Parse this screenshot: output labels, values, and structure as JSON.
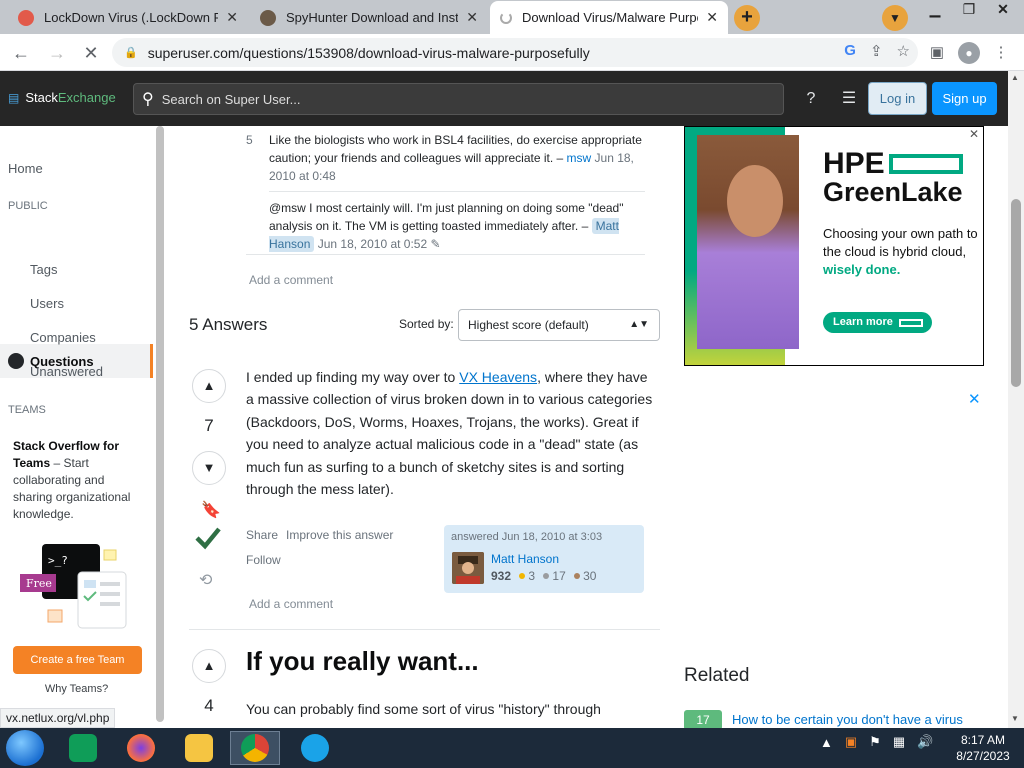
{
  "browser": {
    "tabs": [
      {
        "title": "LockDown Virus (.LockDown Ran",
        "color": "#e25a4a"
      },
      {
        "title": "SpyHunter Download and Install",
        "color": "#5a4a3a"
      },
      {
        "title": "Download Virus/Malware Purpos",
        "color": "#f48225"
      }
    ],
    "url": "superuser.com/questions/153908/download-virus-malware-purposefully",
    "status_url": "vx.netlux.org/vl.php"
  },
  "site": {
    "logo_stack": "Stack",
    "logo_exchange": "Exchange",
    "search_placeholder": "Search on Super User...",
    "login": "Log in",
    "signup": "Sign up"
  },
  "nav": {
    "home": "Home",
    "public": "PUBLIC",
    "questions": "Questions",
    "tags": "Tags",
    "users": "Users",
    "companies": "Companies",
    "unanswered": "Unanswered",
    "teams_section": "TEAMS",
    "teams_title": "Stack Overflow for Teams",
    "teams_desc": " – Start collaborating and sharing organizational knowledge.",
    "free_badge": "Free",
    "create_team": "Create a free Team",
    "why_teams": "Why Teams?"
  },
  "comments": [
    {
      "score": "5",
      "text": "Like the biologists who work in BSL4 facilities, do exercise appropriate caution; your friends and colleagues will appreciate it. –",
      "user": "msw",
      "date": "Jun 18, 2010 at 0:48"
    },
    {
      "score": "",
      "text": "@msw I most certainly will. I'm just planning on doing some \"dead\" analysis on it. The VM is getting toasted immediately after. –",
      "user": "Matt Hanson",
      "date": "Jun 18, 2010 at 0:52"
    }
  ],
  "add_comment": "Add a comment",
  "answers": {
    "count_label": "5 Answers",
    "sorted_by": "Sorted by:",
    "sort_value": "Highest score (default)"
  },
  "answer1": {
    "votes": "7",
    "text_before": "I ended up finding my way over to ",
    "link_text": "VX Heavens",
    "text_after": ", where they have a massive collection of virus broken down in to various categories (Backdoors, DoS, Worms, Hoaxes, Trojans, the works). Great if you need to analyze actual malicious code in a \"dead\" state (as much fun as surfing to a bunch of sketchy sites is and sorting through the mess later).",
    "share": "Share",
    "improve": "Improve this answer",
    "follow": "Follow",
    "answered": "answered Jun 18, 2010 at 3:03",
    "author": "Matt Hanson",
    "rep": "932",
    "gold": "3",
    "silver": "17",
    "bronze": "30"
  },
  "answer2": {
    "votes": "4",
    "title": "If you really want...",
    "body": "You can probably find some sort of virus \"history\" through"
  },
  "ad": {
    "brand": "HPE",
    "product": "GreenLake",
    "text": "Choosing your own path to the cloud is hybrid cloud,",
    "accent": "wisely done.",
    "cta": "Learn more"
  },
  "related": {
    "title": "Related",
    "items": [
      {
        "count": "17",
        "title": "How to be certain you don't have a virus"
      }
    ]
  },
  "taskbar": {
    "time": "8:17 AM",
    "date": "8/27/2023"
  }
}
